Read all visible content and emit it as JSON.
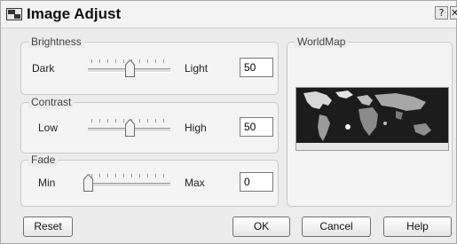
{
  "dialog": {
    "title": "Image Adjust",
    "help_glyph": "?",
    "close_glyph": "✕"
  },
  "brightness": {
    "legend": "Brightness",
    "min_label": "Dark",
    "max_label": "Light",
    "value": "50",
    "level": 0.5
  },
  "contrast": {
    "legend": "Contrast",
    "min_label": "Low",
    "max_label": "High",
    "value": "50",
    "level": 0.5
  },
  "fade": {
    "legend": "Fade",
    "min_label": "Min",
    "max_label": "Max",
    "value": "0",
    "level": 0
  },
  "preview": {
    "legend": "WorldMap"
  },
  "buttons": {
    "reset": "Reset",
    "ok": "OK",
    "cancel": "Cancel",
    "help": "Help"
  },
  "icons": {
    "app": "image-adjust-icon",
    "thumb": "slider-thumb-icon",
    "map": "world-map-image"
  }
}
